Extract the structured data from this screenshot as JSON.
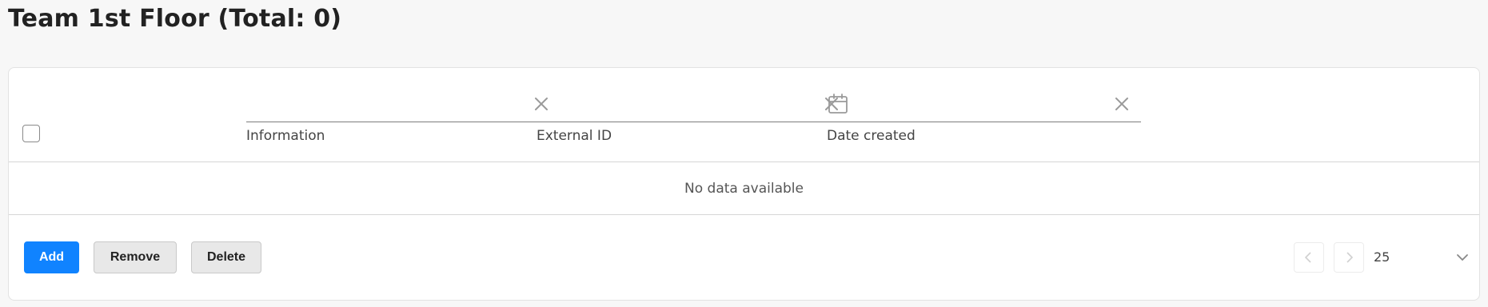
{
  "page": {
    "title": "Team 1st Floor (Total: 0)"
  },
  "table": {
    "filters": [
      {
        "label": "Information",
        "value": "",
        "icon": "close-icon"
      },
      {
        "label": "External ID",
        "value": "",
        "icon": "close-icon"
      },
      {
        "label": "Date created",
        "value": "",
        "icon": "calendar-icon"
      }
    ],
    "empty_text": "No data available"
  },
  "actions": {
    "add_label": "Add",
    "remove_label": "Remove",
    "delete_label": "Delete"
  },
  "pagination": {
    "page_size": "25"
  },
  "colors": {
    "primary": "#1083ff",
    "secondary_bg": "#e8e8e8",
    "page_bg": "#f7f7f7"
  }
}
